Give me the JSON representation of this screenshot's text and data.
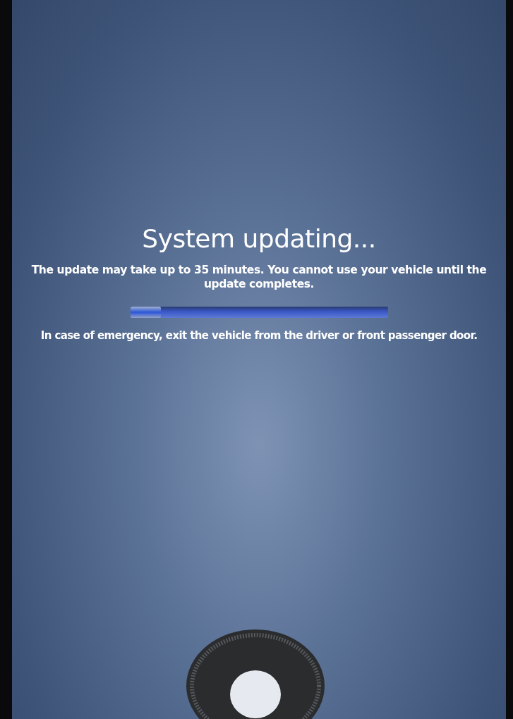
{
  "title": "System updating...",
  "message": "The update may take up to 35 minutes. You cannot use your vehicle until the update completes.",
  "progress": {
    "level": 0.12
  },
  "notice": "In case of emergency, exit the vehicle from the driver or front passenger door."
}
